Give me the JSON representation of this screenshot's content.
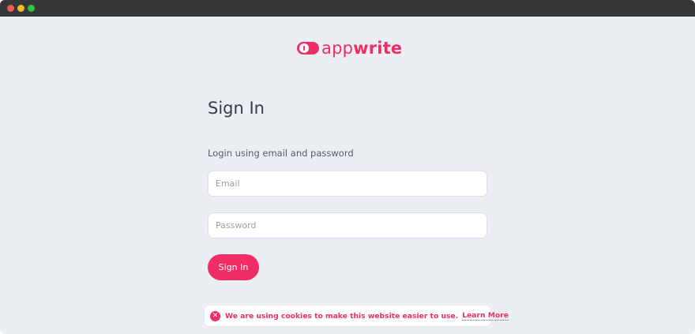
{
  "brand": {
    "logo_light": "app",
    "logo_bold": "write",
    "accent_color": "#f02e65"
  },
  "login": {
    "title": "Sign In",
    "subtitle": "Login using email and password",
    "email_placeholder": "Email",
    "email_value": "",
    "password_placeholder": "Password",
    "password_value": "",
    "submit_label": "Sign In"
  },
  "cookie_notice": {
    "close_icon": "close-circle-icon",
    "message": "We are using cookies to make this website easier to use.",
    "link_label": "Learn More"
  }
}
